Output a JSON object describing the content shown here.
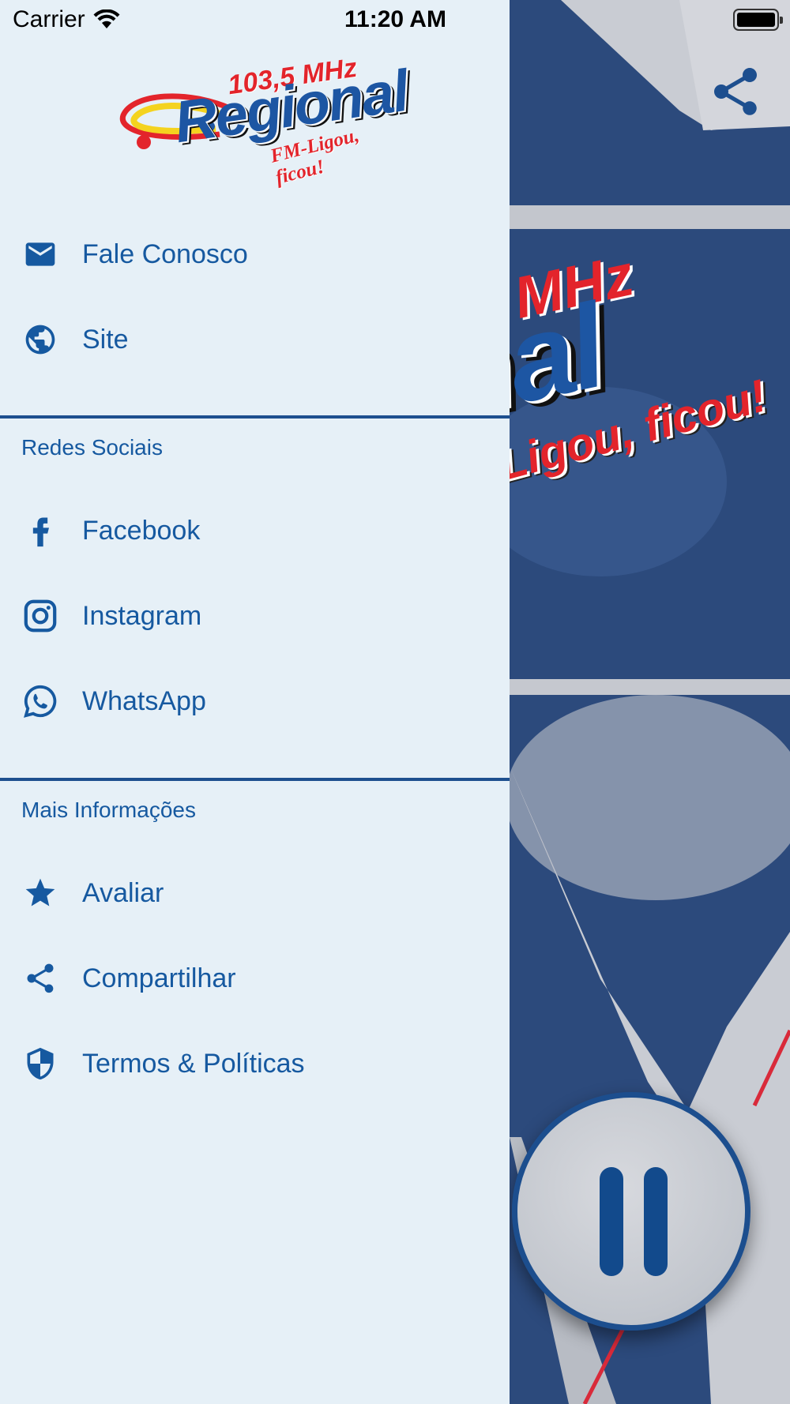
{
  "status_bar": {
    "carrier": "Carrier",
    "time": "11:20 AM"
  },
  "logo": {
    "frequency": "103,5 MHz",
    "name": "Regional",
    "slogan": "FM-Ligou, ficou!"
  },
  "background_logo": {
    "frequency_fragment": "MHz",
    "name_fragment": "onal",
    "slogan_fragment": "M-Ligou, ficou!"
  },
  "menu": {
    "primary": [
      {
        "label": "Fale Conosco",
        "icon": "mail-icon"
      },
      {
        "label": "Site",
        "icon": "globe-icon"
      }
    ],
    "social": {
      "heading": "Redes Sociais",
      "items": [
        {
          "label": "Facebook",
          "icon": "facebook-icon"
        },
        {
          "label": "Instagram",
          "icon": "instagram-icon"
        },
        {
          "label": "WhatsApp",
          "icon": "whatsapp-icon"
        }
      ]
    },
    "more": {
      "heading": "Mais Informações",
      "items": [
        {
          "label": "Avaliar",
          "icon": "star-icon"
        },
        {
          "label": "Compartilhar",
          "icon": "share-icon"
        },
        {
          "label": "Termos & Políticas",
          "icon": "shield-icon"
        }
      ]
    }
  },
  "player": {
    "state_icon": "pause-icon"
  },
  "colors": {
    "drawer_bg": "#e6f0f7",
    "accent": "#1659a0",
    "divider": "#1d4f8f",
    "brand_red": "#e3242b"
  }
}
